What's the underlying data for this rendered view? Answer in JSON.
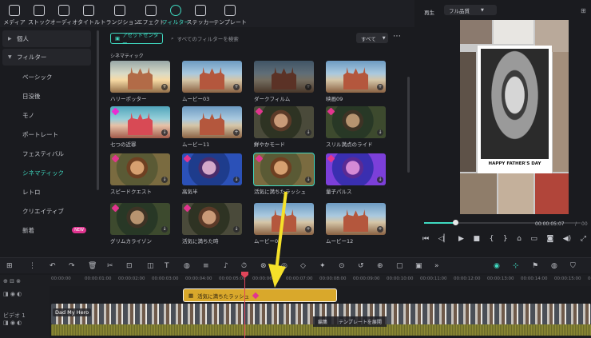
{
  "tool_tabs": [
    {
      "label": "メディア",
      "icon": "media-icon"
    },
    {
      "label": "ストック",
      "icon": "stock-icon"
    },
    {
      "label": "オーディオ",
      "icon": "audio-icon"
    },
    {
      "label": "タイトル",
      "icon": "title-icon"
    },
    {
      "label": "トランジション",
      "icon": "transition-icon"
    },
    {
      "label": "エフェクト",
      "icon": "effect-icon"
    },
    {
      "label": "フィルター",
      "icon": "filter-icon",
      "active": true
    },
    {
      "label": "ステッカー",
      "icon": "sticker-icon"
    },
    {
      "label": "テンプレート",
      "icon": "template-icon"
    }
  ],
  "sidebar": {
    "personal": "個人",
    "filters": "フィルター",
    "subitems": [
      "ベーシック",
      "日没後",
      "モノ",
      "ポートレート",
      "フェスティバル",
      "シネマティック",
      "レトロ",
      "クリエイティブ",
      "新着"
    ],
    "active": "シネマティック",
    "new_badge": "NEW"
  },
  "panel": {
    "asset_center": "アセットセンター",
    "search_placeholder": "すべてのフィルターを検索",
    "all_select": "すべて",
    "section_title": "シネマティック",
    "cards": [
      {
        "name": "ハリーポッター",
        "style": "church warm",
        "gem": false,
        "add": true
      },
      {
        "name": "ムービー03",
        "style": "church",
        "gem": false,
        "add": true
      },
      {
        "name": "ダークフィルム",
        "style": "church dark",
        "gem": false,
        "add": true
      },
      {
        "name": "映画09",
        "style": "church",
        "gem": false,
        "add": true
      },
      {
        "name": "七つの近罪",
        "style": "church teal",
        "gem": true,
        "add": false
      },
      {
        "name": "ムービー11",
        "style": "church",
        "gem": false,
        "add": true
      },
      {
        "name": "鮮やかモード",
        "style": "woman",
        "gem": true,
        "add": false
      },
      {
        "name": "スリル満点のライド",
        "style": "woman green",
        "gem": true,
        "add": false
      },
      {
        "name": "スピードクエスト",
        "style": "woman warmw",
        "gem": true,
        "add": false
      },
      {
        "name": "高気半",
        "style": "woman blue",
        "gem": true,
        "add": false
      },
      {
        "name": "活気に満ちたラッシュ",
        "style": "woman warmw",
        "gem": true,
        "add": false,
        "selected": true
      },
      {
        "name": "量子パルス",
        "style": "woman purple",
        "gem": true,
        "add": false
      },
      {
        "name": "グリムカライゾン",
        "style": "woman green",
        "gem": true,
        "add": false
      },
      {
        "name": "活気に満ちた時",
        "style": "woman",
        "gem": true,
        "add": false
      },
      {
        "name": "ムービー07",
        "style": "church",
        "gem": false,
        "add": true
      },
      {
        "name": "ムービー12",
        "style": "church",
        "gem": false,
        "add": true
      }
    ]
  },
  "preview": {
    "play_label": "再生",
    "quality": "フル品質",
    "caption": "HAPPY FATHER'S DAY",
    "time_current": "00:00:05:07",
    "time_sep": "/",
    "time_total": "00",
    "progress": 0.2
  },
  "timeline": {
    "ruler": [
      "00:00:00",
      "00:00:01:00",
      "00:00:02:00",
      "00:00:03:00",
      "00:00:04:00",
      "00:00:05:00",
      "00:00:06:00",
      "00:00:07:00",
      "00:00:08:00",
      "00:00:09:00",
      "00:00:10:00",
      "00:00:11:00",
      "00:00:12:00",
      "00:00:13:00",
      "00:00:14:00",
      "00:00:15:00",
      "00:00:16:00"
    ],
    "fx_clip": "活気に満ちたラッシュ",
    "video_clip": "Dad My Hero",
    "menu": [
      "編集",
      "テンプレートを展開"
    ],
    "track_label": "ビデオ 1"
  },
  "colors": {
    "accent": "#3fd9c0",
    "premium": "#e2358f",
    "fx_clip": "#d9a82b",
    "playhead": "#e0455a",
    "arrow": "#f5e12a"
  }
}
